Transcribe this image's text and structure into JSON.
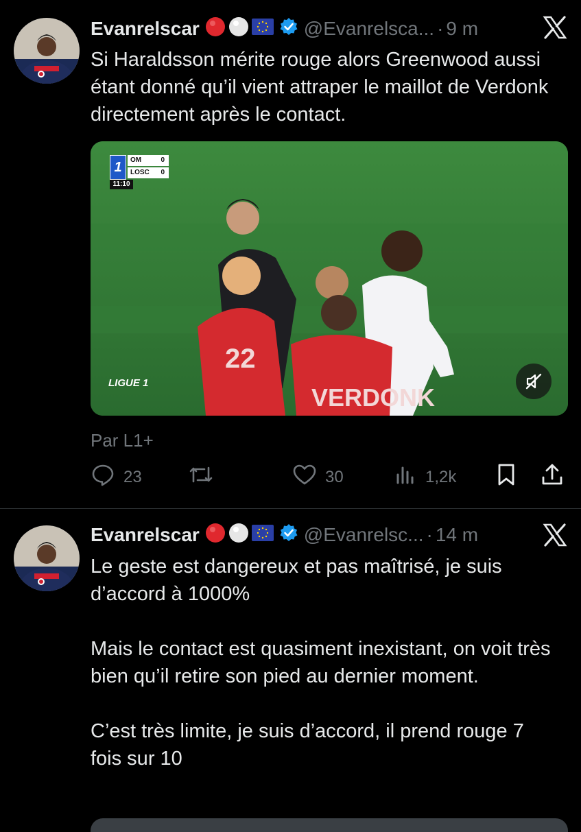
{
  "tweets": [
    {
      "author": "Evanrelscar",
      "handle": "@Evanrelsca...",
      "time": "9 m",
      "paragraphs": [
        "Si Haraldsson mérite rouge alors Greenwood aussi étant donné qu’il vient attraper le maillot de Verdonk directement après le contact."
      ],
      "media": {
        "scoreboard": {
          "team1": "OM",
          "score1": "0",
          "team2": "LOSC",
          "score2": "0",
          "clock": "11:10"
        },
        "league_logo": "LIGUE 1",
        "mute_icon": "speaker-muted-icon"
      },
      "source": "Par L1+",
      "actions": {
        "replies": "23",
        "reposts": "",
        "likes": "30",
        "views": "1,2k"
      }
    },
    {
      "author": "Evanrelscar",
      "handle": "@Evanrelsc...",
      "time": "14 m",
      "paragraphs": [
        "Le geste est dangereux et pas maîtrisé, je suis d’accord à 1000%",
        "Mais le contact est quasiment inexistant, on voit très bien qu’il retire son pied au dernier moment.",
        "C’est très limite, je suis d’accord, il prend rouge 7 fois sur 10"
      ]
    }
  ],
  "colors": {
    "background": "#000000",
    "text": "#e7e9ea",
    "muted": "#71767b",
    "verified": "#1d9bf0",
    "divider": "#2f3336"
  }
}
